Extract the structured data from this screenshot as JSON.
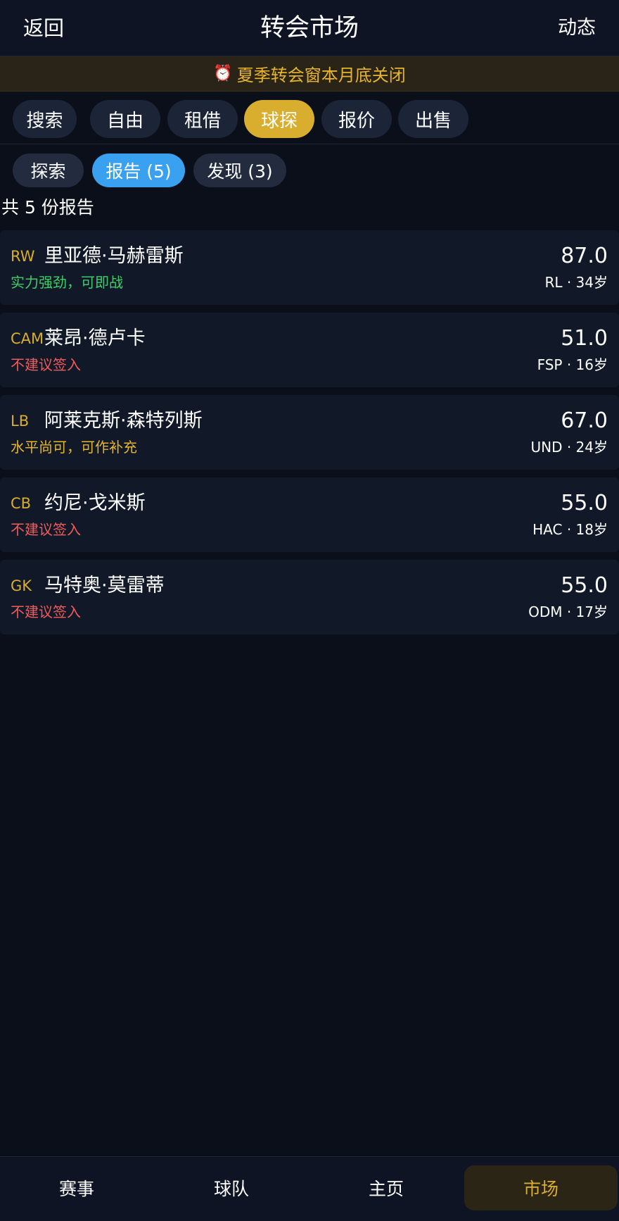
{
  "header": {
    "back_label": "返回",
    "title": "转会市场",
    "activity_label": "动态"
  },
  "banner": {
    "icon": "alarm-clock-icon",
    "text": "夏季转会窗本月底关闭"
  },
  "main_tabs": [
    {
      "label": "搜索"
    },
    {
      "label": "自由"
    },
    {
      "label": "租借"
    },
    {
      "label": "球探",
      "active": true
    },
    {
      "label": "报价"
    },
    {
      "label": "出售"
    }
  ],
  "sub_tabs": [
    {
      "label": "探索"
    },
    {
      "label": "报告 (5)",
      "active": true
    },
    {
      "label": "发现 (3)"
    }
  ],
  "reports_count_label": "共 5 份报告",
  "reports": [
    {
      "position": "RW",
      "name": "里亚德·马赫雷斯",
      "verdict": "实力强劲，可即战",
      "verdict_tone": "good",
      "rating": "87.0",
      "meta": "RL · 34岁"
    },
    {
      "position": "CAM",
      "name": "莱昂·德卢卡",
      "verdict": "不建议签入",
      "verdict_tone": "bad",
      "rating": "51.0",
      "meta": "FSP · 16岁"
    },
    {
      "position": "LB",
      "name": "阿莱克斯·森特列斯",
      "verdict": "水平尚可，可作补充",
      "verdict_tone": "mid",
      "rating": "67.0",
      "meta": "UND · 24岁"
    },
    {
      "position": "CB",
      "name": "约尼·戈米斯",
      "verdict": "不建议签入",
      "verdict_tone": "bad",
      "rating": "55.0",
      "meta": "HAC · 18岁"
    },
    {
      "position": "GK",
      "name": "马特奥·莫雷蒂",
      "verdict": "不建议签入",
      "verdict_tone": "bad",
      "rating": "55.0",
      "meta": "ODM · 17岁"
    }
  ],
  "bottom_nav": [
    {
      "label": "赛事"
    },
    {
      "label": "球队"
    },
    {
      "label": "主页"
    },
    {
      "label": "市场",
      "active": true
    }
  ],
  "colors": {
    "accent_gold": "#d9ad2e",
    "accent_blue": "#3aa0f0",
    "good": "#3ccf69",
    "bad": "#ef5b5b",
    "mid": "#e6b52c"
  }
}
